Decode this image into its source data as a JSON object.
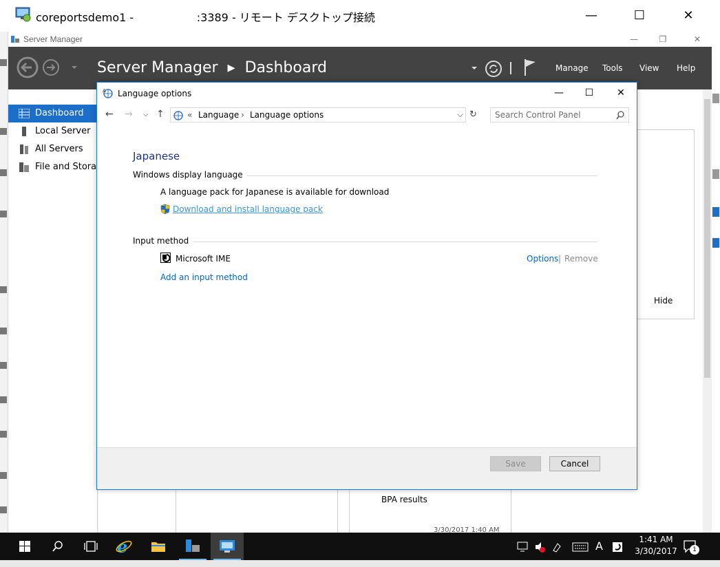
{
  "rdp_window": {
    "title": "coreportsdemo1 -                  :3389 - リモート デスクトップ接続",
    "controls": {
      "minimize": "—",
      "maximize": "☐",
      "close": "✕"
    }
  },
  "server_manager": {
    "title": "Server Manager",
    "breadcrumb": "Server Manager  ▸  Dashboard",
    "menu": [
      "Manage",
      "Tools",
      "View",
      "Help"
    ],
    "nav": [
      {
        "label": "Dashboard",
        "active": true
      },
      {
        "label": "Local Server",
        "active": false
      },
      {
        "label": "All Servers",
        "active": false
      },
      {
        "label": "File and Storage Services",
        "active": false
      }
    ],
    "tiles": {
      "hide": "Hide",
      "bpa": "BPA results",
      "timestamp": "3/30/2017 1:40 AM"
    }
  },
  "dialog": {
    "title": "Language options",
    "address": {
      "prefix": "«",
      "parts": [
        "Language",
        "Language options"
      ]
    },
    "search_placeholder": "Search Control Panel",
    "language": "Japanese",
    "display_section": "Windows display language",
    "pack_text": "A language pack for Japanese is available for download",
    "download_link": "Download and install language pack",
    "input_section": "Input method",
    "ime_name": "Microsoft IME",
    "options_link": "Options",
    "separator": "|",
    "remove_link": "Remove",
    "add_link": "Add an input method",
    "save_label": "Save",
    "cancel_label": "Cancel"
  },
  "taskbar": {
    "time": "1:41 AM",
    "date": "3/30/2017",
    "ime_indicator": "A",
    "notification_count": "1"
  },
  "colors": {
    "accent": "#1c6ec9",
    "header": "#434343",
    "link": "#0066cc",
    "heading": "#1e3287"
  }
}
